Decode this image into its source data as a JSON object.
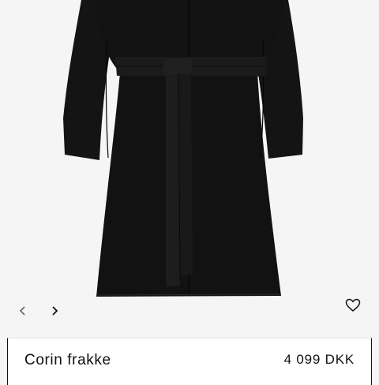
{
  "gallery": {
    "image_alt": "Black coat with belt",
    "prev_icon": "chevron-left-icon",
    "next_icon": "chevron-right-icon",
    "favorite_icon": "heart-outline-icon"
  },
  "product": {
    "name": "Corin frakke",
    "price": "4 099 DKK"
  },
  "colors": {
    "background": "#f5f5f5",
    "coat": "#121212",
    "text": "#111111",
    "card": "#ffffff"
  }
}
